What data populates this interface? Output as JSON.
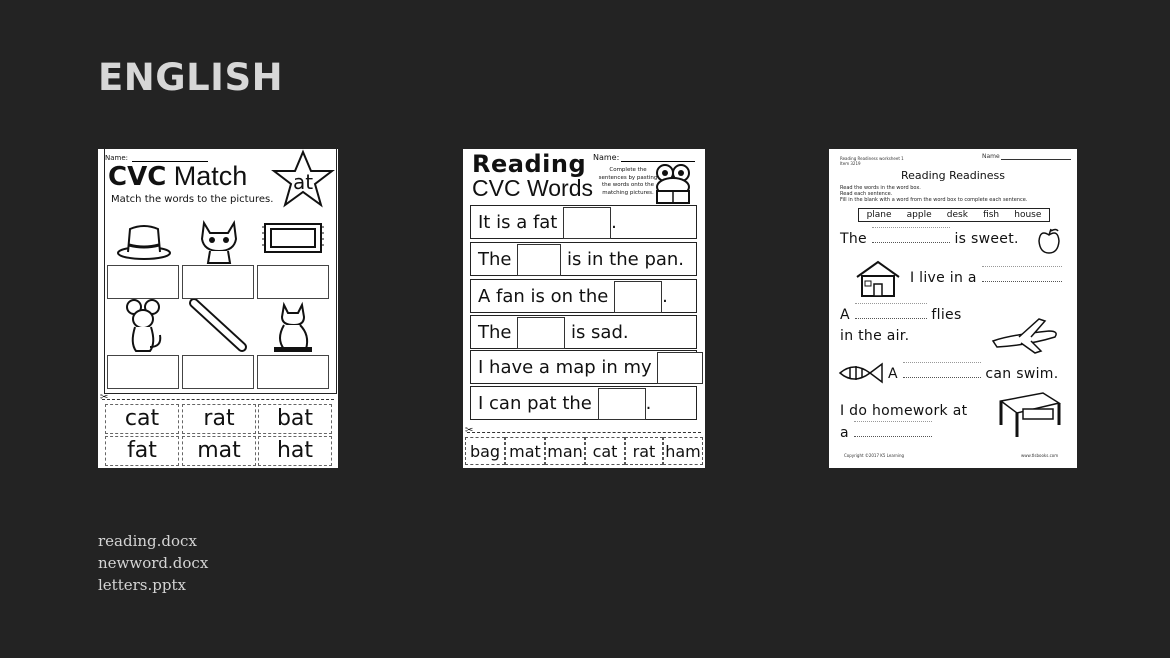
{
  "slide": {
    "title": "ENGLISH"
  },
  "files": [
    "reading.docx",
    "newword.docx",
    "letters.pptx"
  ],
  "worksheet1": {
    "name_label": "Name:",
    "title_bold": "CVC",
    "title_rest": " Match",
    "star_word": "at",
    "subtitle": "Match the words to the pictures.",
    "words": [
      "cat",
      "rat",
      "bat",
      "fat",
      "mat",
      "hat"
    ]
  },
  "worksheet2": {
    "title": "Reading",
    "subtitle": "CVC Words",
    "name_label": "Name:",
    "instructions": "Complete the sentences by pasting the words onto the matching pictures.",
    "sentences": [
      {
        "before": "It is a fat",
        "after": "."
      },
      {
        "before": "The",
        "after": "is in the pan."
      },
      {
        "before": "A fan is on the",
        "after": "."
      },
      {
        "before": "The",
        "after": "is sad."
      },
      {
        "before": "I have a map in my",
        "after": "."
      },
      {
        "before": "I can pat the",
        "after": "."
      }
    ],
    "words": [
      "bag",
      "mat",
      "man",
      "cat",
      "rat",
      "ham"
    ]
  },
  "worksheet3": {
    "header_left": "Reading Readiness worksheet 1",
    "header_left_2": "Item 3219",
    "name_label": "Name",
    "title": "Reading Readiness",
    "instructions": [
      "Read the words in the word box.",
      "Read each sentence.",
      "Fill in the blank with a word from the word box to complete each sentence."
    ],
    "word_bank": [
      "plane",
      "apple",
      "desk",
      "fish",
      "house"
    ],
    "s1_before": "The",
    "s1_after": "is sweet.",
    "s2_before": "I live in a",
    "s3_before": "A",
    "s3_after": "flies",
    "s3_line2": "in the air.",
    "s4_before": "A",
    "s4_after": "can swim.",
    "s5_line1": "I do homework at",
    "s5_line2": "a",
    "footer_left": "Copyright ©2017 K5 Learning",
    "footer_right": "www.tlsbooks.com"
  }
}
